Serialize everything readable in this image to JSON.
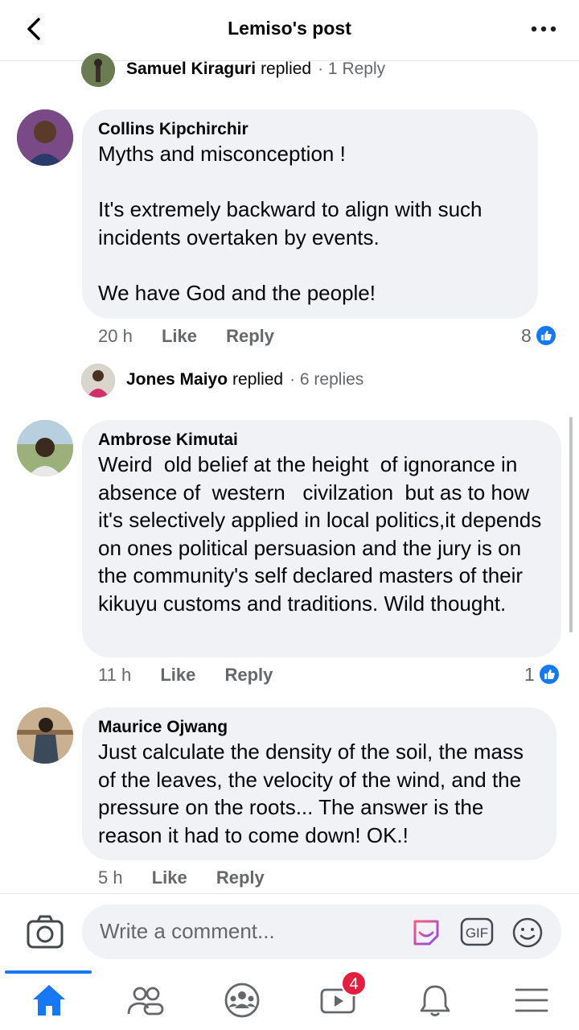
{
  "header": {
    "title": "Lemiso's post"
  },
  "top_reply": {
    "name": "Samuel Kiraguri",
    "verb": "replied",
    "count": "· 1 Reply"
  },
  "comments": [
    {
      "name": "Collins Kipchirchir",
      "text": "Myths and misconception !\n\nIt's extremely backward to align with such incidents overtaken by events.\n\nWe have God and the people!",
      "time": "20 h",
      "like": "Like",
      "reply": "Reply",
      "reactions": "8",
      "replied": {
        "name": "Jones Maiyo",
        "verb": "replied",
        "count": "· 6 replies"
      }
    },
    {
      "name": "Ambrose Kimutai",
      "text": "Weird  old belief at the height  of ignorance in absence of  western   civilzation  but as to how it's selectively applied in local politics,it depends on ones political persuasion and the jury is on the community's self declared masters of their kikuyu customs and traditions. Wild thought.",
      "time": "11 h",
      "like": "Like",
      "reply": "Reply",
      "reactions": "1"
    },
    {
      "name": "Maurice Ojwang",
      "text": "Just calculate the density of the soil, the mass of the leaves, the velocity of the wind, and the pressure on the roots... The answer is the reason it had to come down! OK.!",
      "time": "5 h",
      "like": "Like",
      "reply": "Reply"
    }
  ],
  "composer": {
    "placeholder": "Write a comment...",
    "gif_label": "GIF"
  },
  "nav": {
    "video_badge": "4"
  },
  "icons": [
    "back-icon",
    "more-icon",
    "camera-icon",
    "sticker-icon",
    "gif-icon",
    "emoji-icon",
    "home-icon",
    "friends-icon",
    "groups-icon",
    "video-icon",
    "bell-icon",
    "menu-icon",
    "like-icon"
  ],
  "colors": {
    "accent": "#1877f2",
    "bubble": "#f0f2f5",
    "meta": "#65676b",
    "badge": "#e41e3f"
  }
}
